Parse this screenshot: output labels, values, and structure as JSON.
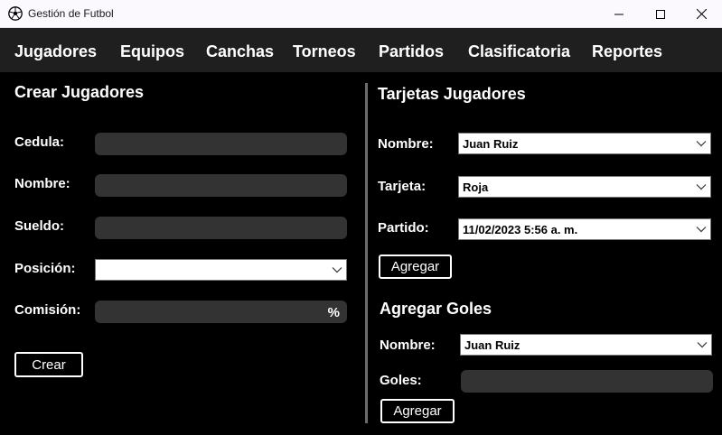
{
  "window": {
    "title": "Gestión de Futbol",
    "app_icon": "soccer-ball-icon"
  },
  "menu": {
    "items": [
      "Jugadores",
      "Equipos",
      "Canchas",
      "Torneos",
      "Partidos",
      "Clasificatoria",
      "Reportes"
    ]
  },
  "crear": {
    "title": "Crear Jugadores",
    "cedula_label": "Cedula:",
    "cedula_value": "",
    "nombre_label": "Nombre:",
    "nombre_value": "",
    "sueldo_label": "Sueldo:",
    "sueldo_value": "",
    "posicion_label": "Posición:",
    "posicion_value": "",
    "comision_label": "Comisión:",
    "comision_value": "",
    "comision_suffix": "%",
    "button": "Crear"
  },
  "tarjetas": {
    "title": "Tarjetas Jugadores",
    "nombre_label": "Nombre:",
    "nombre_value": "Juan Ruiz",
    "tarjeta_label": "Tarjeta:",
    "tarjeta_value": "Roja",
    "partido_label": "Partido:",
    "partido_value": "11/02/2023 5:56 a. m.",
    "button": "Agregar"
  },
  "goles": {
    "title": "Agregar Goles",
    "nombre_label": "Nombre:",
    "nombre_value": "Juan Ruiz",
    "goles_label": "Goles:",
    "goles_value": "",
    "button": "Agregar"
  },
  "colors": {
    "background": "#000000",
    "menubar": "#1f1f1f",
    "input": "#333333",
    "titlebar": "#fbf8fe"
  }
}
